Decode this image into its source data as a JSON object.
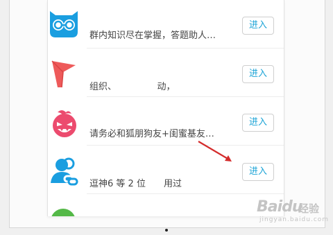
{
  "colors": {
    "accent": "#1aa3d6",
    "icon_blue": "#1a9ee0",
    "icon_red": "#ee5a5a",
    "icon_pink": "#ec4b6e",
    "icon_green": "#54b847",
    "arrow": "#d42c2c"
  },
  "apps": [
    {
      "icon": "owl-glasses-icon",
      "description": "群内知识尽在掌握，答题助人…",
      "button_label": "进入"
    },
    {
      "icon": "red-flag-icon",
      "description": "组织、　　　　　动，",
      "button_label": "进入"
    },
    {
      "icon": "angry-face-icon",
      "description": "请务必和狐朋狗友+闺蜜基友…",
      "button_label": "进入"
    },
    {
      "icon": "people-link-icon",
      "description": "逗神6 等 2 位　　用过",
      "button_label": "进入"
    },
    {
      "icon": "green-app-icon",
      "description": "",
      "button_label": ""
    }
  ],
  "watermark": {
    "brand": "Baidu",
    "chinese": "经验",
    "url": "jingyan.baidu.com"
  }
}
